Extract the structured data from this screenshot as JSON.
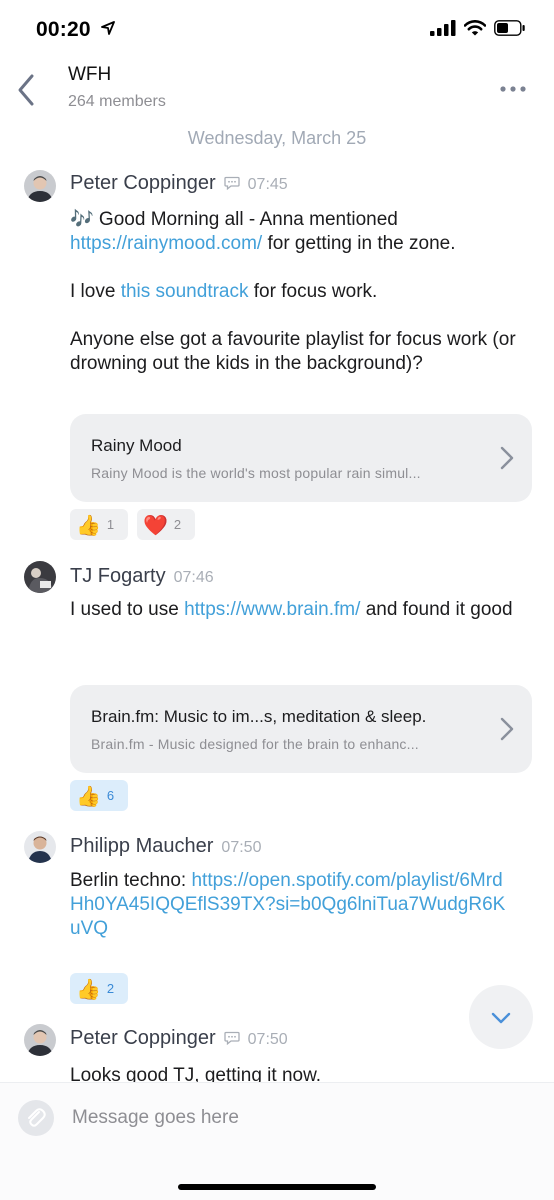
{
  "status_bar": {
    "time": "00:20"
  },
  "header": {
    "title": "WFH",
    "subtitle": "264 members"
  },
  "date_separator": "Wednesday, March 25",
  "messages": [
    {
      "author": "Peter Coppinger",
      "time": "07:45",
      "line1_pre": "🎶 Good Morning all - Anna mentioned ",
      "line1_link": "https://rainymood.com/",
      "line1_post": " for getting in the zone.",
      "para2_pre": "I love ",
      "para2_link": "this soundtrack",
      "para2_post": " for focus work.",
      "para3": "Anyone else got a favourite playlist for focus work (or drowning out the kids in the background)?",
      "preview": {
        "title": "Rainy Mood",
        "description": "Rainy Mood is the world's most popular rain simul..."
      },
      "reactions": [
        {
          "emoji": "👍",
          "count": "1"
        },
        {
          "emoji": "❤️",
          "count": "2"
        }
      ]
    },
    {
      "author": "TJ Fogarty",
      "time": "07:46",
      "pre": "I used to use ",
      "link": "https://www.brain.fm/",
      "post": " and found it good",
      "preview": {
        "title": "Brain.fm: Music to im...s, meditation & sleep.",
        "description": "Brain.fm - Music designed for the brain to enhanc..."
      },
      "reactions": [
        {
          "emoji": "👍",
          "count": "6"
        }
      ]
    },
    {
      "author": "Philipp Maucher",
      "time": "07:50",
      "pre": "Berlin techno: ",
      "link": "https://open.spotify.com/playlist/6MrdHh0YA45IQQEflS39TX?si=b0Qg6lniTua7WudgR6KuVQ",
      "reactions": [
        {
          "emoji": "👍",
          "count": "2"
        }
      ]
    },
    {
      "author": "Peter Coppinger",
      "time": "07:50",
      "text": "Looks good TJ, getting it now."
    }
  ],
  "composer": {
    "placeholder": "Message goes here"
  },
  "icons": {
    "navigation": "navigation-arrow-icon",
    "signal": "cellular-signal-icon",
    "wifi": "wifi-icon",
    "battery": "battery-icon",
    "back": "chevron-left-icon",
    "more": "more-dots-icon",
    "edited": "speech-bubble-icon",
    "preview_open": "chevron-right-icon",
    "scroll_down": "chevron-down-icon",
    "attach": "paperclip-icon"
  },
  "colors": {
    "link": "#42a0d9",
    "accent_reaction_bg": "#dcedfb",
    "muted_text": "#8e8e93"
  }
}
